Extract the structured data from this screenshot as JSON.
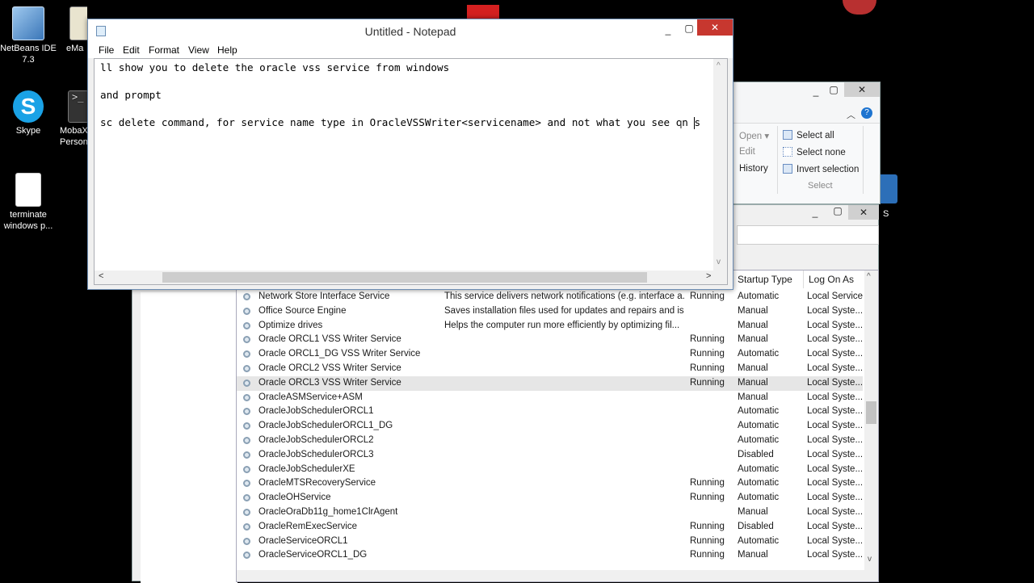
{
  "desktop": {
    "icons": [
      {
        "label": "NetBeans IDE 7.3",
        "icon": "netbeans-icon"
      },
      {
        "label": "eMa",
        "icon": "certificate-icon"
      },
      {
        "label": "Skype",
        "icon": "skype-icon"
      },
      {
        "label": "MobaX Person",
        "icon": "terminal-icon"
      },
      {
        "label": "terminate windows p...",
        "icon": "text-file-icon"
      },
      {
        "label": "S",
        "icon": "app-icon"
      }
    ]
  },
  "notepad": {
    "title": "Untitled - Notepad",
    "menu": [
      "File",
      "Edit",
      "Format",
      "View",
      "Help"
    ],
    "lines": [
      "ll show you to delete the oracle vss service from windows",
      "and prompt",
      "sc delete command, for service name type in OracleVSSWriter<servicename> and not what you see on s"
    ],
    "scroll_left": "<",
    "scroll_right": ">",
    "scroll_up": "^",
    "scroll_down": "v"
  },
  "ribbon": {
    "open_label": "Open",
    "edit_label": "Edit",
    "history_label": "History",
    "select_all_label": "Select all",
    "select_none_label": "Select none",
    "invert_selection_label": "Invert selection",
    "group_label": "Select"
  },
  "services": {
    "columns": [
      "Startup Type",
      "Log On As"
    ],
    "rows": [
      {
        "name": "Network Store Interface Service",
        "description": "This service delivers network notifications (e.g. interface a...",
        "status": "Running",
        "startup": "Automatic",
        "logon": "Local Service"
      },
      {
        "name": "Office  Source Engine",
        "description": "Saves installation files used for updates and repairs and is ...",
        "status": "",
        "startup": "Manual",
        "logon": "Local Syste..."
      },
      {
        "name": "Optimize drives",
        "description": "Helps the computer run more efficiently by optimizing fil...",
        "status": "",
        "startup": "Manual",
        "logon": "Local Syste..."
      },
      {
        "name": "Oracle ORCL1 VSS Writer Service",
        "description": "",
        "status": "Running",
        "startup": "Manual",
        "logon": "Local Syste..."
      },
      {
        "name": "Oracle ORCL1_DG VSS Writer Service",
        "description": "",
        "status": "Running",
        "startup": "Automatic",
        "logon": "Local Syste..."
      },
      {
        "name": "Oracle ORCL2 VSS Writer Service",
        "description": "",
        "status": "Running",
        "startup": "Manual",
        "logon": "Local Syste..."
      },
      {
        "name": "Oracle ORCL3 VSS Writer Service",
        "description": "",
        "status": "Running",
        "startup": "Manual",
        "logon": "Local Syste..."
      },
      {
        "name": "OracleASMService+ASM",
        "description": "",
        "status": "",
        "startup": "Manual",
        "logon": "Local Syste..."
      },
      {
        "name": "OracleJobSchedulerORCL1",
        "description": "",
        "status": "",
        "startup": "Automatic",
        "logon": "Local Syste..."
      },
      {
        "name": "OracleJobSchedulerORCL1_DG",
        "description": "",
        "status": "",
        "startup": "Automatic",
        "logon": "Local Syste..."
      },
      {
        "name": "OracleJobSchedulerORCL2",
        "description": "",
        "status": "",
        "startup": "Automatic",
        "logon": "Local Syste..."
      },
      {
        "name": "OracleJobSchedulerORCL3",
        "description": "",
        "status": "",
        "startup": "Disabled",
        "logon": "Local Syste..."
      },
      {
        "name": "OracleJobSchedulerXE",
        "description": "",
        "status": "",
        "startup": "Automatic",
        "logon": "Local Syste..."
      },
      {
        "name": "OracleMTSRecoveryService",
        "description": "",
        "status": "Running",
        "startup": "Automatic",
        "logon": "Local Syste..."
      },
      {
        "name": "OracleOHService",
        "description": "",
        "status": "Running",
        "startup": "Automatic",
        "logon": "Local Syste..."
      },
      {
        "name": "OracleOraDb11g_home1ClrAgent",
        "description": "",
        "status": "",
        "startup": "Manual",
        "logon": "Local Syste..."
      },
      {
        "name": "OracleRemExecService",
        "description": "",
        "status": "Running",
        "startup": "Disabled",
        "logon": "Local Syste..."
      },
      {
        "name": "OracleServiceORCL1",
        "description": "",
        "status": "Running",
        "startup": "Automatic",
        "logon": "Local Syste..."
      },
      {
        "name": "OracleServiceORCL1_DG",
        "description": "",
        "status": "Running",
        "startup": "Manual",
        "logon": "Local Syste..."
      }
    ],
    "selected_row": 6
  }
}
